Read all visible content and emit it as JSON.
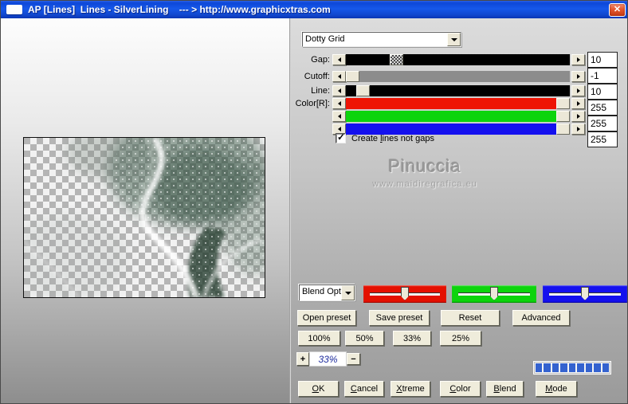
{
  "window": {
    "title": "AP [Lines]  Lines - SilverLining    --- > http://www.graphicxtras.com"
  },
  "icons": {
    "close": "✕",
    "check": "✓"
  },
  "filter_dropdown": {
    "value": "Dotty Grid"
  },
  "sliders": [
    {
      "label": "Gap:",
      "value": "10",
      "track_color": "#000000",
      "thumb_pct": 21,
      "thumb_style": "hatched"
    },
    {
      "label": "Cutoff:",
      "value": "-1",
      "track_color": "#8c8c8c",
      "thumb_pct": 0,
      "thumb_style": "plain"
    },
    {
      "label": "Line:",
      "value": "10",
      "track_color": "#000000",
      "thumb_pct": 5,
      "thumb_style": "plain"
    },
    {
      "label": "Color[R]:",
      "value": "255",
      "track_color": "#ee1404",
      "thumb_pct": 100,
      "thumb_style": "plain"
    },
    {
      "label": "",
      "value": "255",
      "track_color": "#0cd40c",
      "thumb_pct": 100,
      "thumb_style": "plain"
    },
    {
      "label": "",
      "value": "255",
      "track_color": "#1410ee",
      "thumb_pct": 100,
      "thumb_style": "plain"
    }
  ],
  "checkbox": {
    "label": "Create &lines not gaps",
    "checked": true
  },
  "watermark": {
    "line1": "Pinuccia",
    "line2": "www.maidiregrafica.eu"
  },
  "blend_dropdown": {
    "value": "Blend Opti"
  },
  "mixers": [
    {
      "name": "red-mixer",
      "color": "#e41000",
      "thumb_pct": 50
    },
    {
      "name": "green-mixer",
      "color": "#0cd40c",
      "thumb_pct": 50
    },
    {
      "name": "blue-mixer",
      "color": "#1410ee",
      "thumb_pct": 50
    }
  ],
  "preset_buttons": {
    "open": "Open preset",
    "save": "Save preset",
    "reset": "Reset",
    "advanced": "Advanced"
  },
  "zoom_buttons": {
    "b100": "100%",
    "b50": "50%",
    "b33": "33%",
    "b25": "25%"
  },
  "zoom_stepper": {
    "plus": "+",
    "value": "33%",
    "minus": "−"
  },
  "progress": {
    "segments": 9,
    "color": "#3462cf"
  },
  "action_buttons": {
    "ok": "&OK",
    "cancel": "&Cancel",
    "xtreme": "&Xtreme",
    "color": "&Color",
    "blend": "&Blend",
    "mode": "&Mode"
  }
}
